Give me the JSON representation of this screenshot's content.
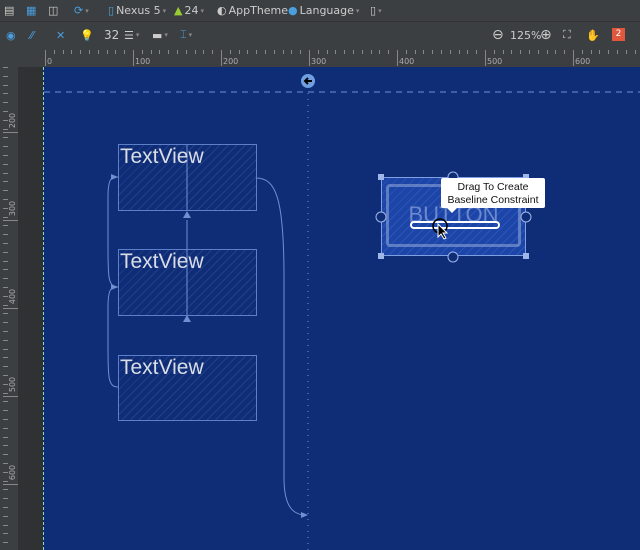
{
  "toolbar1": {
    "device": "Nexus 5",
    "api": "24",
    "theme": "AppTheme",
    "language": "Language"
  },
  "toolbar2": {
    "margin": "32",
    "zoom": "125%",
    "error_count": "2"
  },
  "rulers": {
    "horizontal": [
      "0",
      "100",
      "200",
      "300",
      "400",
      "500",
      "600"
    ],
    "vertical": [
      "200",
      "300",
      "400",
      "500",
      "600"
    ]
  },
  "canvas": {
    "textviews": [
      "TextView",
      "TextView",
      "TextView"
    ],
    "button_label": "BUTTON",
    "tooltip": [
      "Drag To Create",
      "Baseline Constraint"
    ]
  },
  "colors": {
    "blueprint": "#0f2d77",
    "accent": "#4a9fe0",
    "error": "#e0573e"
  }
}
